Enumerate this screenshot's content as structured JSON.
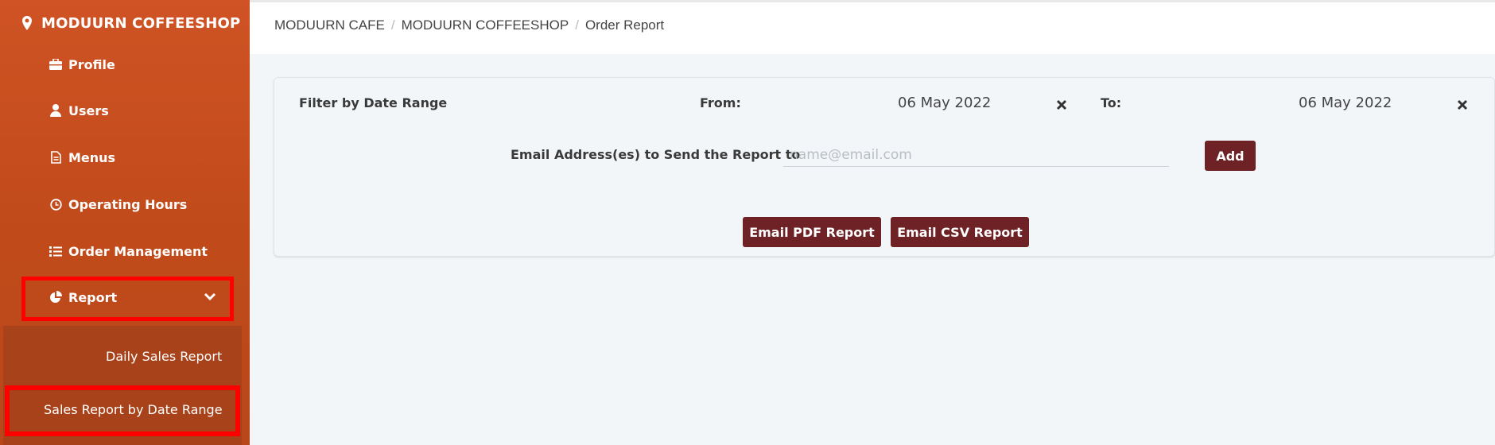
{
  "sidebar": {
    "brand": "MODUURN COFFEESHOP",
    "items": [
      {
        "label": "Profile",
        "icon": "briefcase-icon"
      },
      {
        "label": "Users",
        "icon": "user-icon"
      },
      {
        "label": "Menus",
        "icon": "document-icon"
      },
      {
        "label": "Operating Hours",
        "icon": "clock-icon"
      },
      {
        "label": "Order Management",
        "icon": "list-icon"
      },
      {
        "label": "Report",
        "icon": "pie-chart-icon"
      }
    ],
    "submenu": [
      "Daily Sales Report",
      "Sales Report by Date Range"
    ]
  },
  "breadcrumb": [
    "MODUURN CAFE",
    "MODUURN COFFEESHOP",
    "Order Report"
  ],
  "filter": {
    "title": "Filter by Date Range",
    "from_label": "From:",
    "from_value": "06 May 2022",
    "to_label": "To:",
    "to_value": "06 May 2022",
    "email_label": "Email Address(es) to Send the Report to",
    "email_value": "",
    "email_placeholder": "name@email.com",
    "add_label": "Add"
  },
  "actions": {
    "pdf_label": "Email PDF Report",
    "csv_label": "Email CSV Report"
  },
  "colors": {
    "sidebar": "#c74d1d",
    "button": "#6e2225",
    "highlight": "#ff0000"
  }
}
